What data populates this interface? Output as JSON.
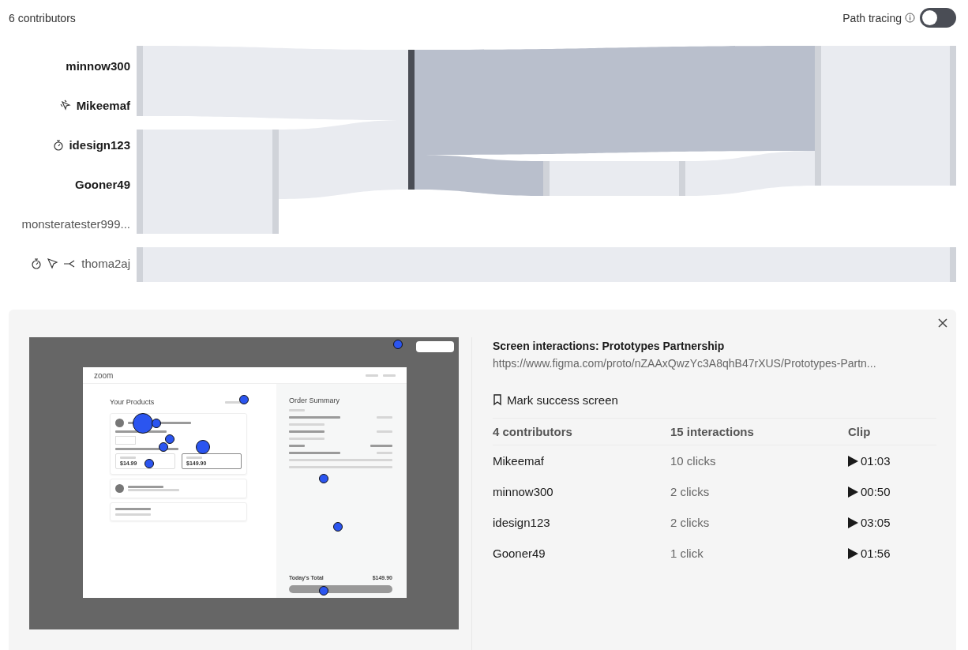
{
  "header": {
    "count": "6 contributors",
    "path_tracing": {
      "label": "Path tracing",
      "on": false
    }
  },
  "contributors": [
    {
      "name": "minnow300",
      "highlighted": true
    },
    {
      "name": "Mikeemaf",
      "highlighted": true,
      "clicks": true
    },
    {
      "name": "idesign123",
      "highlighted": true,
      "timer": true
    },
    {
      "name": "Gooner49",
      "highlighted": true
    },
    {
      "name": "monsteratester999...",
      "highlighted": false
    },
    {
      "name": "thoma2aj",
      "highlighted": false,
      "timer": true,
      "pointer": true,
      "branch": true
    }
  ],
  "preview": {
    "brand": "zoom",
    "title": "Your Products",
    "plans": [
      {
        "price": "$14.99",
        "selected": false
      },
      {
        "price": "$149.90",
        "selected": true
      }
    ],
    "summary": {
      "title": "Order Summary",
      "today": {
        "label": "Today's Total",
        "value": "$149.90"
      }
    }
  },
  "detail": {
    "title": "Screen interactions: Prototypes Partnership",
    "url": "https://www.figma.com/proto/nZAAxQwzYc3A8qhB47rXUS/Prototypes-Partn...",
    "mark": "Mark success screen",
    "columns": [
      "4 contributors",
      "15 interactions",
      "Clip"
    ],
    "rows": [
      {
        "name": "Mikeemaf",
        "clicks": "10 clicks",
        "clip": "01:03"
      },
      {
        "name": "minnow300",
        "clicks": "2 clicks",
        "clip": "00:50"
      },
      {
        "name": "idesign123",
        "clicks": "2 clicks",
        "clip": "03:05"
      },
      {
        "name": "Gooner49",
        "clicks": "1 click",
        "clip": "01:56"
      }
    ]
  }
}
